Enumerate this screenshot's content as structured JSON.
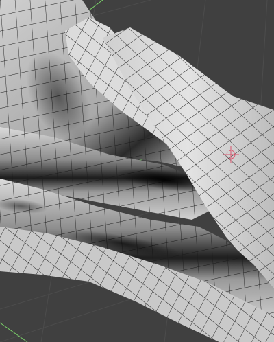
{
  "viewport": {
    "name": "3d-viewport",
    "background_color": "#404040",
    "grid_color": "#4a4a4a",
    "mesh_fill_light": "#d8d8d8",
    "mesh_fill_dark": "#111111",
    "wire_color": "#1a1a1a",
    "axis_x_color": "#c0392b",
    "axis_y_color": "#7bd36a",
    "cursor_color": "#d9536b"
  },
  "objects": [
    {
      "name": "cloth-mesh",
      "type": "subdivided-plane",
      "state": "draped-with-folds"
    }
  ],
  "icons": [
    "3d-cursor-icon"
  ]
}
